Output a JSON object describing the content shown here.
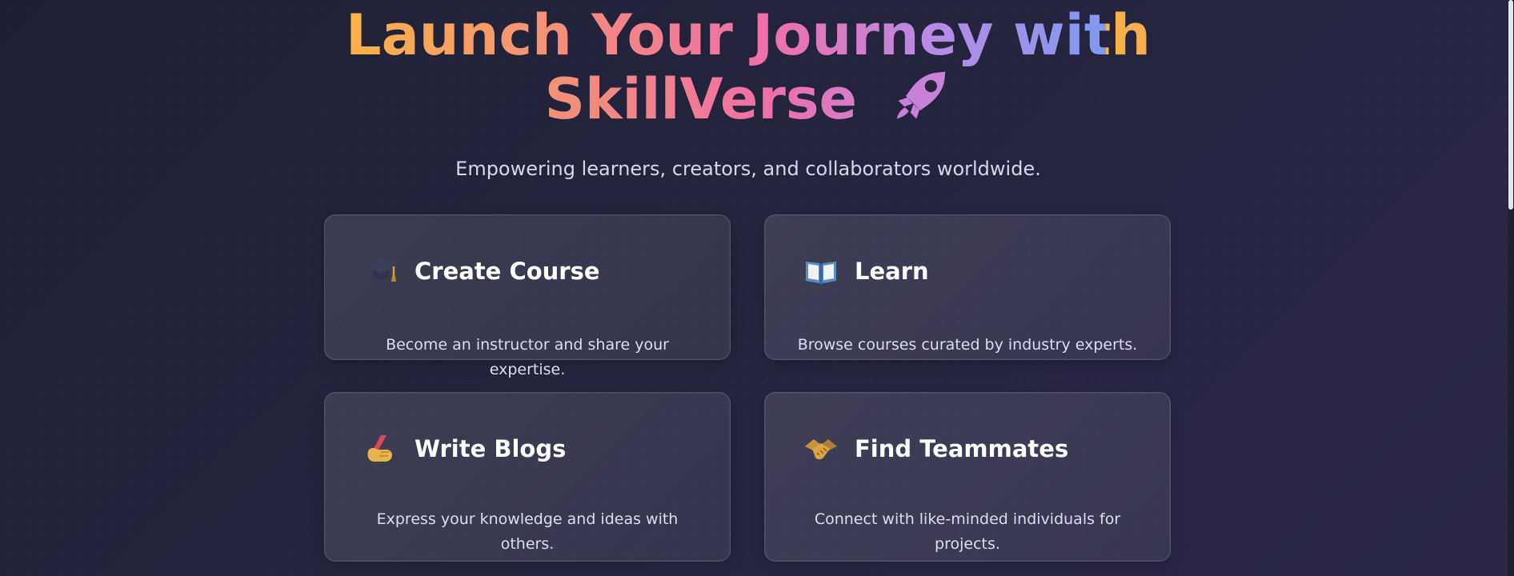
{
  "hero": {
    "title_line_1": "Launch Your Journey with",
    "title_line_2": "SkillVerse",
    "subtitle": "Empowering learners, creators, and collaborators worldwide.",
    "title_gradient_colors": [
      "#f8b446",
      "#f38e79",
      "#f06fa8",
      "#b98ae6",
      "#7f9aef"
    ],
    "icon": "rocket-icon"
  },
  "cards": [
    {
      "icon": "graduation-cap-icon",
      "title": "Create Course",
      "description": "Become an instructor and share your expertise."
    },
    {
      "icon": "open-book-icon",
      "title": "Learn",
      "description": "Browse courses curated by industry experts."
    },
    {
      "icon": "writing-hand-icon",
      "title": "Write Blogs",
      "description": "Express your knowledge and ideas with others."
    },
    {
      "icon": "handshake-icon",
      "title": "Find Teammates",
      "description": "Connect with like-minded individuals for projects."
    }
  ],
  "colors": {
    "background": "#24243d",
    "card_background": "#3c3b52",
    "text_primary": "#ffffff",
    "text_secondary": "#ddddf0",
    "rocket": "#c880d8"
  }
}
